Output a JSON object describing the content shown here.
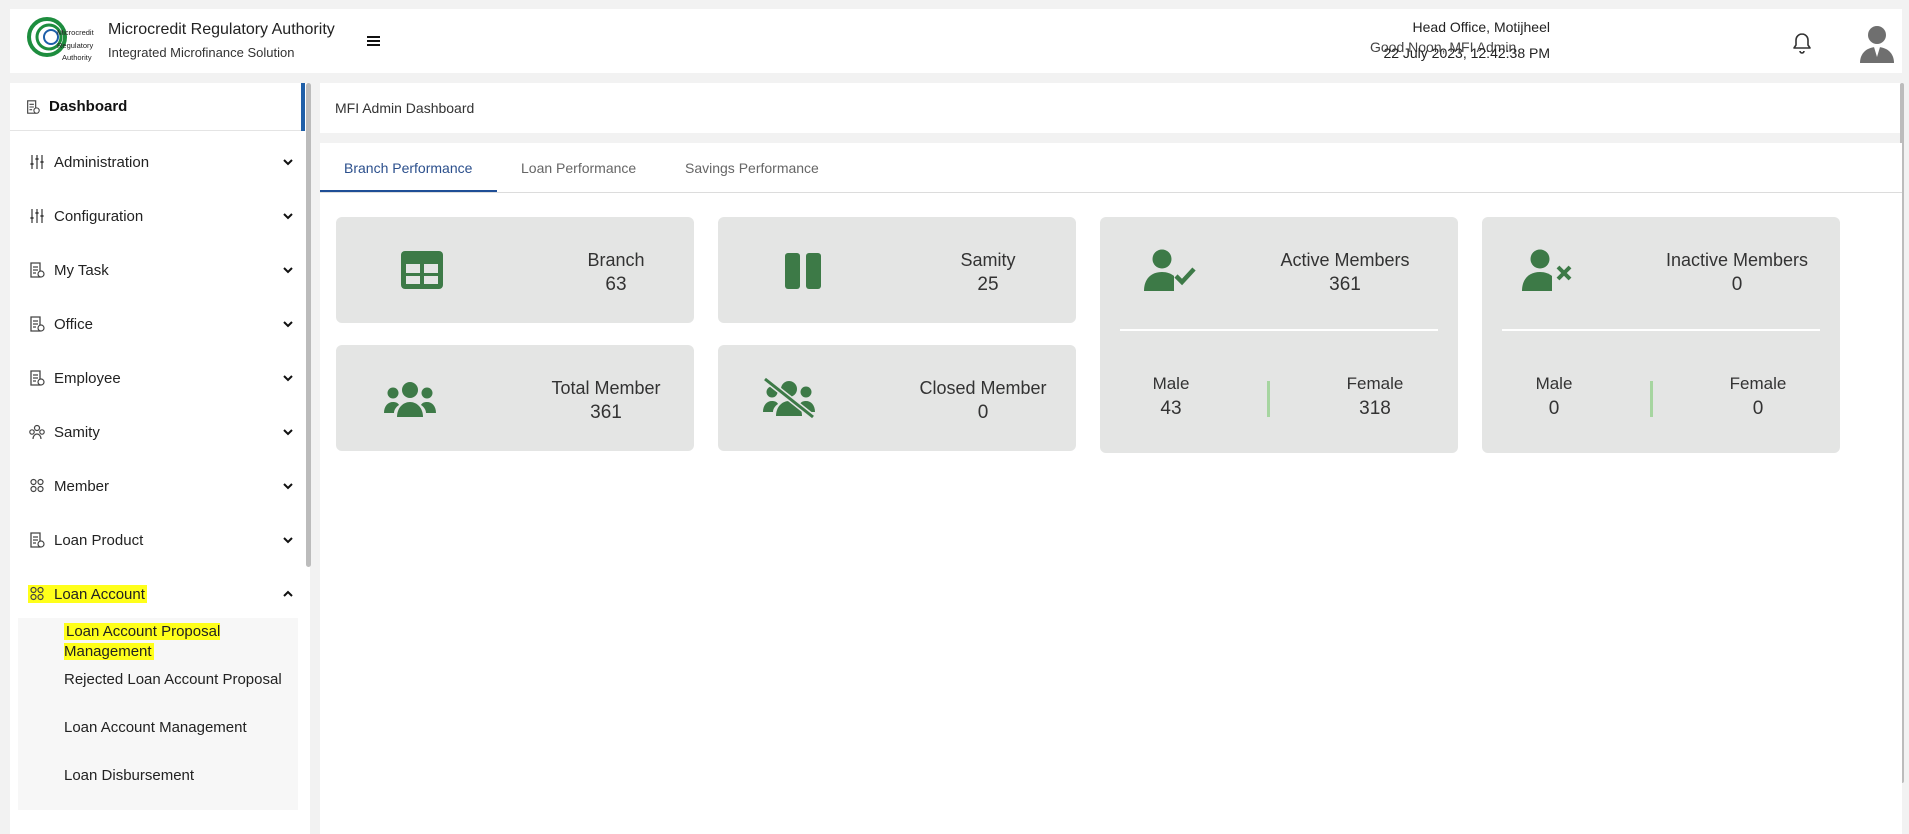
{
  "header": {
    "org_name": "Microcredit Regulatory Authority",
    "app_subtitle": "Integrated Microfinance Solution",
    "logo_text": [
      "Microcredit",
      "Regulatory",
      "Authority"
    ],
    "greeting": "Good Noon, MFI Admin",
    "office": "Head Office, Motijheel",
    "datetime": "22 July 2023, 12:42:38 PM",
    "icons": {
      "menu": "hamburger-icon",
      "notifications": "bell-icon",
      "profile": "user-avatar-icon"
    }
  },
  "sidebar": {
    "dashboard_label": "Dashboard",
    "items": [
      {
        "label": "Administration",
        "icon": "sliders-icon",
        "expanded": false
      },
      {
        "label": "Configuration",
        "icon": "sliders-icon",
        "expanded": false
      },
      {
        "label": "My Task",
        "icon": "document-icon",
        "expanded": false
      },
      {
        "label": "Office",
        "icon": "document-icon",
        "expanded": false
      },
      {
        "label": "Employee",
        "icon": "document-icon",
        "expanded": false
      },
      {
        "label": "Samity",
        "icon": "group-icon",
        "expanded": false
      },
      {
        "label": "Member",
        "icon": "members-icon",
        "expanded": false
      },
      {
        "label": "Loan Product",
        "icon": "document-icon",
        "expanded": false
      },
      {
        "label": "Loan Account",
        "icon": "members-icon",
        "expanded": true,
        "highlighted": true
      }
    ],
    "loan_account_sub": [
      {
        "label": "Loan Account Proposal Management",
        "highlighted": true
      },
      {
        "label": "Rejected Loan Account Proposal",
        "highlighted": false
      },
      {
        "label": "Loan Account Management",
        "highlighted": false
      },
      {
        "label": "Loan Disbursement",
        "highlighted": false
      }
    ]
  },
  "page": {
    "breadcrumb": "MFI Admin Dashboard",
    "tabs": [
      "Branch Performance",
      "Loan Performance",
      "Savings Performance"
    ],
    "active_tab": "Branch Performance"
  },
  "cards": {
    "branch": {
      "title": "Branch",
      "value": "63",
      "icon": "table-grid-icon"
    },
    "samity": {
      "title": "Samity",
      "value": "25",
      "icon": "columns-icon"
    },
    "total_member": {
      "title": "Total Member",
      "value": "361",
      "icon": "users-icon"
    },
    "closed_member": {
      "title": "Closed Member",
      "value": "0",
      "icon": "users-slash-icon"
    },
    "active_members": {
      "title": "Active Members",
      "value": "361",
      "male_label": "Male",
      "male": "43",
      "female_label": "Female",
      "female": "318",
      "icon": "user-check-icon"
    },
    "inactive_members": {
      "title": "Inactive Members",
      "value": "0",
      "male_label": "Male",
      "male": "0",
      "female_label": "Female",
      "female": "0",
      "icon": "user-x-icon"
    }
  },
  "colors": {
    "card_bg": "#e4e5e4",
    "icon_green": "#3d7a47",
    "active_tab": "#1f4e96",
    "highlight": "#ffff1a",
    "separator_green": "#a6d5a0"
  }
}
